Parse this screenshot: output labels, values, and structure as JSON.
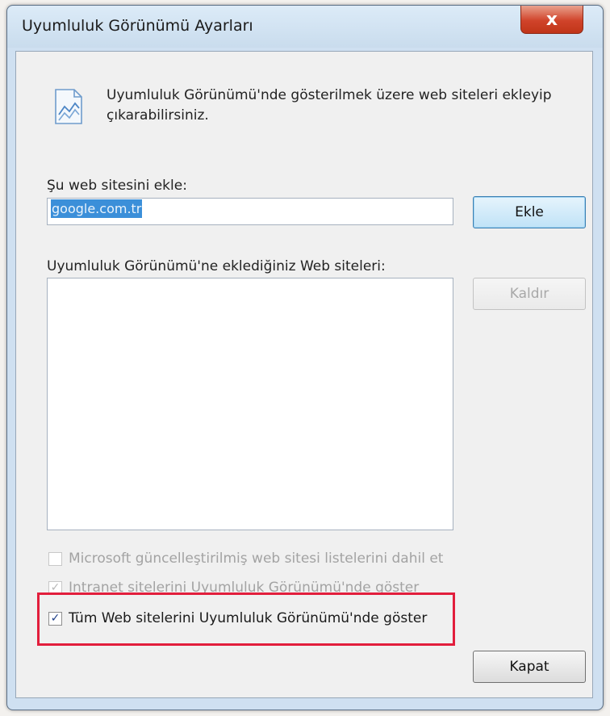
{
  "window": {
    "title": "Uyumluluk Görünümü Ayarları",
    "close_glyph": "x"
  },
  "info": {
    "icon": "page-picture-icon",
    "text": "Uyumluluk Görünümü'nde gösterilmek üzere web siteleri ekleyip çıkarabilirsiniz."
  },
  "add_site": {
    "label": "Şu web sitesini ekle:",
    "value": "google.com.tr",
    "button_label": "Ekle"
  },
  "site_list": {
    "label": "Uyumluluk Görünümü'ne eklediğiniz Web siteleri:",
    "items": [],
    "remove_label": "Kaldır"
  },
  "options": [
    {
      "label": "Microsoft güncelleştirilmiş web sitesi listelerini dahil et",
      "checked": false,
      "enabled": false
    },
    {
      "label": "Intranet sitelerini Uyumluluk Görünümü'nde göster",
      "checked": true,
      "enabled": false
    },
    {
      "label": "Tüm Web sitelerini Uyumluluk Görünümü'nde göster",
      "checked": true,
      "enabled": true
    }
  ],
  "footer": {
    "close_label": "Kapat"
  },
  "colors": {
    "highlight_border": "#e21e3c",
    "selection": "#3b8fd9",
    "close_button": "#d0432a"
  }
}
